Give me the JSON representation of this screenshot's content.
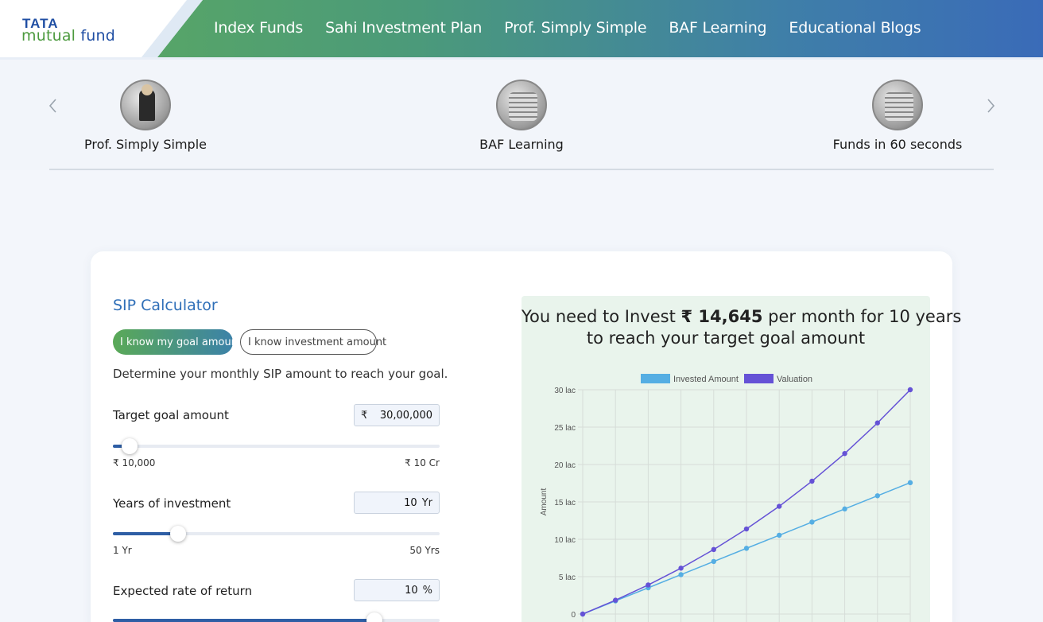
{
  "brand": {
    "line1": "TATA",
    "line2_a": "mutual",
    "line2_b": "fund"
  },
  "nav": [
    "Index Funds",
    "Sahi Investment Plan",
    "Prof. Simply Simple",
    "BAF Learning",
    "Educational Blogs"
  ],
  "carousel": {
    "items": [
      {
        "label": "Prof. Simply Simple",
        "icon": "professor-avatar-icon"
      },
      {
        "label": "BAF Learning",
        "icon": "coins-avatar-icon"
      },
      {
        "label": "Funds in 60 seconds",
        "icon": "coins-avatar-icon"
      }
    ]
  },
  "calculator": {
    "title": "SIP Calculator",
    "mode_active": "I know my goal amount",
    "mode_inactive": "I know investment amount",
    "description": "Determine your monthly SIP amount to reach your goal.",
    "target": {
      "label": "Target goal amount",
      "prefix": "₹",
      "value": "30,00,000",
      "min": "₹ 10,000",
      "max": "₹ 10 Cr",
      "level": 0.05
    },
    "years": {
      "label": "Years of investment",
      "value": "10",
      "suffix": "Yr",
      "min": "1 Yr",
      "max": "50 Yrs",
      "level": 0.2
    },
    "rate": {
      "label": "Expected rate of return",
      "value": "10",
      "suffix": "%",
      "level": 0.8
    }
  },
  "result": {
    "pre": "You need to Invest",
    "amount": "₹ 14,645",
    "post": "per month for 10 years",
    "line2": "to reach your target goal amount"
  },
  "chart_data": {
    "type": "line",
    "ylabel": "Amount",
    "ylim": [
      0,
      30
    ],
    "yticks": [
      "0",
      "5 lac",
      "10 lac",
      "15 lac",
      "20 lac",
      "25 lac",
      "30 lac"
    ],
    "legend_position": "top",
    "series": [
      {
        "name": "Invested Amount",
        "color": "#55aee3",
        "values": [
          0,
          1.76,
          3.51,
          5.27,
          7.03,
          8.79,
          10.54,
          12.3,
          14.06,
          15.82,
          17.57
        ]
      },
      {
        "name": "Valuation",
        "color": "#6552d6",
        "values": [
          0,
          1.85,
          3.89,
          6.14,
          8.63,
          11.38,
          14.41,
          17.77,
          21.47,
          25.56,
          30.0
        ]
      }
    ]
  }
}
